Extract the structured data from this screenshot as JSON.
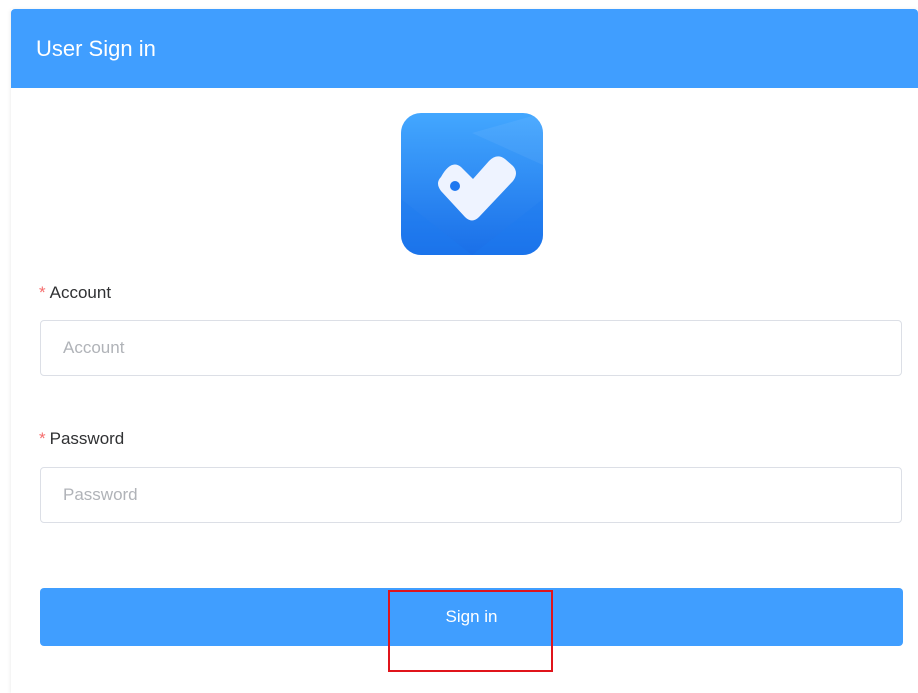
{
  "header": {
    "title": "User Sign in"
  },
  "logo": {
    "icon": "app-logo-icon",
    "colors": {
      "background_top": "#43a7ff",
      "background_bottom": "#1a6fe8",
      "glyph": "#eef3ff",
      "dot": "#1f78f0"
    }
  },
  "form": {
    "account": {
      "required_mark": "*",
      "label": "Account",
      "placeholder": "Account",
      "value": ""
    },
    "password": {
      "required_mark": "*",
      "label": "Password",
      "placeholder": "Password",
      "value": ""
    },
    "submit_label": "Sign in"
  },
  "colors": {
    "primary": "#409eff",
    "required": "#f56c6c",
    "highlight": "#e0141b"
  }
}
